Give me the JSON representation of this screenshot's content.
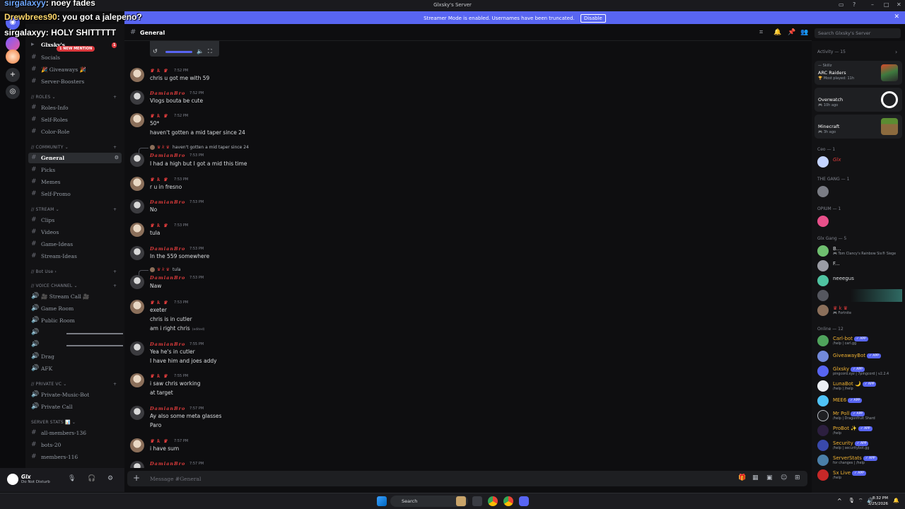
{
  "window": {
    "title": "Glxsky's Server"
  },
  "banner": {
    "text": "Streamer Mode is enabled. Usernames have been truncated.",
    "button": "Disable"
  },
  "overlay": [
    {
      "user": "sirgalaxyy",
      "text": "noey fades"
    },
    {
      "user": "Drewbrees90",
      "text": "you got a jalepeno?"
    },
    {
      "user": "sirgalaxyy",
      "text": "HOLY SHITTTTT"
    }
  ],
  "server": {
    "name": "Glxsky's",
    "mention_badge": "1 NEW MENTION",
    "notif_count": "1"
  },
  "channels": {
    "top": [
      "Socials",
      "🎉 Giveaways 🎉",
      "Server-Boosters"
    ],
    "cat_roles": "// ROLES",
    "roles": [
      "Roles-Info",
      "Self-Roles",
      "Color-Role"
    ],
    "cat_community": "// COMMUNITY",
    "community": [
      "General",
      "Picks",
      "Memes",
      "Self-Promo"
    ],
    "cat_stream": "// STREAM",
    "stream": [
      "Clips",
      "Videos",
      "Game-Ideas",
      "Stream-Ideas"
    ],
    "cat_botuse": "// Bot Use",
    "cat_voice": "// VOICE CHANNEL",
    "voice": [
      "🎥 Stream Call 🎥",
      "Game Room",
      "Public Room",
      "Drag",
      "AFK"
    ],
    "cat_private": "// PRIVATE VC",
    "private": [
      "Private-Music-Bot",
      "Private Call"
    ],
    "cat_stats": "SERVER STATS 📊",
    "stats": [
      "all-members-136",
      "bots-20",
      "members-116"
    ]
  },
  "user": {
    "name": "Glx",
    "status": "Do Not Disturb"
  },
  "header": {
    "channel": "General",
    "search_placeholder": "Search Glxsky's Server"
  },
  "composer": {
    "placeholder": "Message #General"
  },
  "messages": [
    {
      "author": "♛ k ♛",
      "time": "7:52 PM",
      "lines": [
        "chris u got me with 59"
      ]
    },
    {
      "author": "DamianBro",
      "time": "7:52 PM",
      "lines": [
        "Vlogs bouta be cute"
      ]
    },
    {
      "author": "♛ k ♛",
      "time": "7:52 PM",
      "lines": [
        "50*",
        "haven't gotten a mid taper since 24"
      ]
    },
    {
      "author": "DamianBro",
      "time": "7:53 PM",
      "reply": "haven't gotten a mid taper since 24",
      "lines": [
        "I had a high but I got a mid this time"
      ]
    },
    {
      "author": "♛ k ♛",
      "time": "7:53 PM",
      "lines": [
        "r u in fresno"
      ]
    },
    {
      "author": "DamianBro",
      "time": "7:53 PM",
      "lines": [
        "No"
      ]
    },
    {
      "author": "♛ k ♛",
      "time": "7:53 PM",
      "lines": [
        "tula"
      ]
    },
    {
      "author": "DamianBro",
      "time": "7:53 PM",
      "lines": [
        "In the 559 somewhere"
      ]
    },
    {
      "author": "DamianBro",
      "time": "7:53 PM",
      "reply": "tula",
      "lines": [
        "Naw"
      ]
    },
    {
      "author": "♛ k ♛",
      "time": "7:53 PM",
      "lines": [
        "exeter",
        "chris is in cutler",
        "am i right chris"
      ],
      "edited": "(edited)"
    },
    {
      "author": "DamianBro",
      "time": "7:55 PM",
      "lines": [
        "Yea he's in cutler",
        "I have him and joes addy"
      ]
    },
    {
      "author": "♛ k ♛",
      "time": "7:55 PM",
      "lines": [
        "i saw chris working",
        "at target"
      ]
    },
    {
      "author": "DamianBro",
      "time": "7:57 PM",
      "lines": [
        "Ay also some meta glasses",
        "Paro"
      ]
    },
    {
      "author": "♛ k ♛",
      "time": "7:57 PM",
      "lines": [
        "i have sum"
      ]
    },
    {
      "author": "DamianBro",
      "time": "7:57 PM",
      "lines": []
    }
  ],
  "members": {
    "activity_head": "Activity — 15",
    "activities": [
      {
        "top": "— Skillz",
        "game": "ARC Raiders",
        "sub": "🏆 Most played: 11h"
      },
      {
        "top": "",
        "game": "Overwatch",
        "sub": "🎮 10h ago"
      },
      {
        "top": "",
        "game": "Minecraft",
        "sub": "🎮 3h ago"
      }
    ],
    "groups": [
      {
        "head": "Ceo — 1",
        "items": [
          {
            "name": "Glx",
            "sub": ""
          }
        ]
      },
      {
        "head": "THE GANG — 1",
        "items": [
          {
            "name": "",
            "sub": ""
          }
        ]
      },
      {
        "head": "OPIUM — 1",
        "items": [
          {
            "name": "",
            "sub": ""
          }
        ]
      },
      {
        "head": "Glx Gang — 5",
        "items": [
          {
            "name": "B...",
            "sub": "🎮 Tom Clancy's Rainbow Six® Siege"
          },
          {
            "name": "F...",
            "sub": ""
          },
          {
            "name": "neeegus",
            "sub": ""
          },
          {
            "name": "",
            "sub": ""
          },
          {
            "name": "♛ k ♛",
            "sub": "🎮 Fortnite"
          }
        ]
      },
      {
        "head": "Online — 12",
        "items": [
          {
            "name": "Carl-bot",
            "sub": "/help | carl.gg",
            "app": "✓ APP"
          },
          {
            "name": "GiveawayBot",
            "sub": "",
            "app": "✓ APP"
          },
          {
            "name": "Glxsky",
            "sub": "pingcord.xyz | 7pingcord | v2.2.4",
            "app": "✓ APP"
          },
          {
            "name": "LunaBot 🌙",
            "sub": "/help | /help",
            "app": "✓ APP"
          },
          {
            "name": "MEE6",
            "sub": "",
            "app": "✓ APP"
          },
          {
            "name": "Mr Poll",
            "sub": "/help | Dragonfruit Shard",
            "app": "✓ APP"
          },
          {
            "name": "ProBot ✨",
            "sub": "/help",
            "app": "✓ APP"
          },
          {
            "name": "Security",
            "sub": "/help | securitybot.gg",
            "app": "✓ APP"
          },
          {
            "name": "ServerStats",
            "sub": "for changes | /help",
            "app": "✓ APP"
          },
          {
            "name": "Sx Live",
            "sub": "/help",
            "app": "✓ APP"
          }
        ]
      }
    ]
  },
  "taskbar": {
    "search": "Search",
    "time": "8:32 PM",
    "date": "3/25/2026"
  },
  "colors": {
    "accent": "#5865f2",
    "author_red": "#e23c3c",
    "bg": "#0e0e10"
  }
}
